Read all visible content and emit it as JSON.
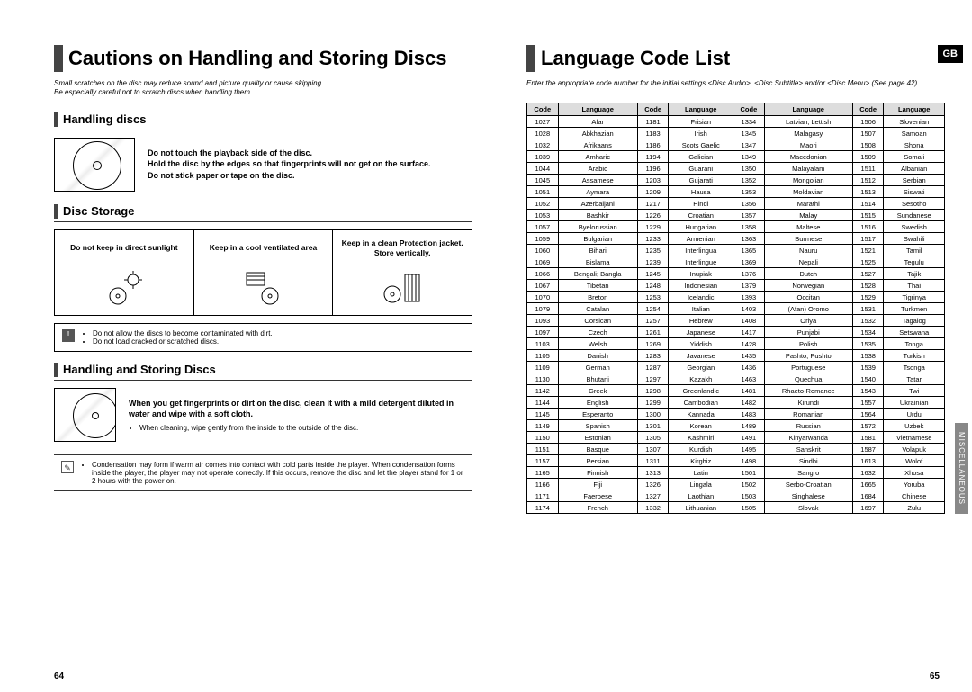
{
  "left": {
    "title": "Cautions on Handling and Storing Discs",
    "intro1": "Small scratches on the disc may reduce sound and picture quality or cause skipping.",
    "intro2": "Be especially careful not to scratch discs when handling them.",
    "h1": "Handling discs",
    "handling_t1": "Do not touch the playback side of the disc.",
    "handling_t2": "Hold the disc by the edges so that fingerprints will not get on the surface.",
    "handling_t3": "Do not stick paper or tape on the disc.",
    "h2": "Disc Storage",
    "storage": [
      "Do not keep in direct sunlight",
      "Keep in a cool ventilated area",
      "Keep in a clean Protection jacket. Store vertically."
    ],
    "note1_a": "Do not allow the discs to become contaminated with dirt.",
    "note1_b": "Do not load cracked or scratched discs.",
    "h3": "Handling and Storing Discs",
    "clean_bold": "When you get fingerprints or dirt on the disc, clean it with a mild detergent diluted in water and wipe with a soft cloth.",
    "clean_bullet": "When cleaning, wipe gently from the inside to the outside of the disc.",
    "note2": "Condensation may form if warm air comes into contact with cold parts inside the player. When condensation forms inside the player, the player may not operate correctly. If this occurs, remove the disc and let the player stand for 1 or 2 hours with the power on.",
    "page": "64"
  },
  "right": {
    "title": "Language Code List",
    "badge": "GB",
    "intro": "Enter the appropriate code number for the initial settings <Disc Audio>, <Disc Subtitle> and/or <Disc Menu> (See page 42).",
    "th_code": "Code",
    "th_lang": "Language",
    "side": "MISCELLANEOUS",
    "page": "65"
  },
  "chart_data": {
    "type": "table",
    "title": "Language Code List",
    "columns": [
      "Code",
      "Language"
    ],
    "rows": [
      [
        "1027",
        "Afar"
      ],
      [
        "1028",
        "Abkhazian"
      ],
      [
        "1032",
        "Afrikaans"
      ],
      [
        "1039",
        "Amharic"
      ],
      [
        "1044",
        "Arabic"
      ],
      [
        "1045",
        "Assamese"
      ],
      [
        "1051",
        "Aymara"
      ],
      [
        "1052",
        "Azerbaijani"
      ],
      [
        "1053",
        "Bashkir"
      ],
      [
        "1057",
        "Byelorussian"
      ],
      [
        "1059",
        "Bulgarian"
      ],
      [
        "1060",
        "Bihari"
      ],
      [
        "1069",
        "Bislama"
      ],
      [
        "1066",
        "Bengali; Bangla"
      ],
      [
        "1067",
        "Tibetan"
      ],
      [
        "1070",
        "Breton"
      ],
      [
        "1079",
        "Catalan"
      ],
      [
        "1093",
        "Corsican"
      ],
      [
        "1097",
        "Czech"
      ],
      [
        "1103",
        "Welsh"
      ],
      [
        "1105",
        "Danish"
      ],
      [
        "1109",
        "German"
      ],
      [
        "1130",
        "Bhutani"
      ],
      [
        "1142",
        "Greek"
      ],
      [
        "1144",
        "English"
      ],
      [
        "1145",
        "Esperanto"
      ],
      [
        "1149",
        "Spanish"
      ],
      [
        "1150",
        "Estonian"
      ],
      [
        "1151",
        "Basque"
      ],
      [
        "1157",
        "Persian"
      ],
      [
        "1165",
        "Finnish"
      ],
      [
        "1166",
        "Fiji"
      ],
      [
        "1171",
        "Faeroese"
      ],
      [
        "1174",
        "French"
      ],
      [
        "1181",
        "Frisian"
      ],
      [
        "1183",
        "Irish"
      ],
      [
        "1186",
        "Scots Gaelic"
      ],
      [
        "1194",
        "Galician"
      ],
      [
        "1196",
        "Guarani"
      ],
      [
        "1203",
        "Gujarati"
      ],
      [
        "1209",
        "Hausa"
      ],
      [
        "1217",
        "Hindi"
      ],
      [
        "1226",
        "Croatian"
      ],
      [
        "1229",
        "Hungarian"
      ],
      [
        "1233",
        "Armenian"
      ],
      [
        "1235",
        "Interlingua"
      ],
      [
        "1239",
        "Interlingue"
      ],
      [
        "1245",
        "Inupiak"
      ],
      [
        "1248",
        "Indonesian"
      ],
      [
        "1253",
        "Icelandic"
      ],
      [
        "1254",
        "Italian"
      ],
      [
        "1257",
        "Hebrew"
      ],
      [
        "1261",
        "Japanese"
      ],
      [
        "1269",
        "Yiddish"
      ],
      [
        "1283",
        "Javanese"
      ],
      [
        "1287",
        "Georgian"
      ],
      [
        "1297",
        "Kazakh"
      ],
      [
        "1298",
        "Greenlandic"
      ],
      [
        "1299",
        "Cambodian"
      ],
      [
        "1300",
        "Kannada"
      ],
      [
        "1301",
        "Korean"
      ],
      [
        "1305",
        "Kashmiri"
      ],
      [
        "1307",
        "Kurdish"
      ],
      [
        "1311",
        "Kirghiz"
      ],
      [
        "1313",
        "Latin"
      ],
      [
        "1326",
        "Lingala"
      ],
      [
        "1327",
        "Laothian"
      ],
      [
        "1332",
        "Lithuanian"
      ],
      [
        "1334",
        "Latvian, Lettish"
      ],
      [
        "1345",
        "Malagasy"
      ],
      [
        "1347",
        "Maori"
      ],
      [
        "1349",
        "Macedonian"
      ],
      [
        "1350",
        "Malayalam"
      ],
      [
        "1352",
        "Mongolian"
      ],
      [
        "1353",
        "Moldavian"
      ],
      [
        "1356",
        "Marathi"
      ],
      [
        "1357",
        "Malay"
      ],
      [
        "1358",
        "Maltese"
      ],
      [
        "1363",
        "Burmese"
      ],
      [
        "1365",
        "Nauru"
      ],
      [
        "1369",
        "Nepali"
      ],
      [
        "1376",
        "Dutch"
      ],
      [
        "1379",
        "Norwegian"
      ],
      [
        "1393",
        "Occitan"
      ],
      [
        "1403",
        "(Afan) Oromo"
      ],
      [
        "1408",
        "Oriya"
      ],
      [
        "1417",
        "Punjabi"
      ],
      [
        "1428",
        "Polish"
      ],
      [
        "1435",
        "Pashto, Pushto"
      ],
      [
        "1436",
        "Portuguese"
      ],
      [
        "1463",
        "Quechua"
      ],
      [
        "1481",
        "Rhaeto-Romance"
      ],
      [
        "1482",
        "Kirundi"
      ],
      [
        "1483",
        "Romanian"
      ],
      [
        "1489",
        "Russian"
      ],
      [
        "1491",
        "Kinyarwanda"
      ],
      [
        "1495",
        "Sanskrit"
      ],
      [
        "1498",
        "Sindhi"
      ],
      [
        "1501",
        "Sangro"
      ],
      [
        "1502",
        "Serbo-Croatian"
      ],
      [
        "1503",
        "Singhalese"
      ],
      [
        "1505",
        "Slovak"
      ],
      [
        "1506",
        "Slovenian"
      ],
      [
        "1507",
        "Samoan"
      ],
      [
        "1508",
        "Shona"
      ],
      [
        "1509",
        "Somali"
      ],
      [
        "1511",
        "Albanian"
      ],
      [
        "1512",
        "Serbian"
      ],
      [
        "1513",
        "Siswati"
      ],
      [
        "1514",
        "Sesotho"
      ],
      [
        "1515",
        "Sundanese"
      ],
      [
        "1516",
        "Swedish"
      ],
      [
        "1517",
        "Swahili"
      ],
      [
        "1521",
        "Tamil"
      ],
      [
        "1525",
        "Tegulu"
      ],
      [
        "1527",
        "Tajik"
      ],
      [
        "1528",
        "Thai"
      ],
      [
        "1529",
        "Tigrinya"
      ],
      [
        "1531",
        "Turkmen"
      ],
      [
        "1532",
        "Tagalog"
      ],
      [
        "1534",
        "Setswana"
      ],
      [
        "1535",
        "Tonga"
      ],
      [
        "1538",
        "Turkish"
      ],
      [
        "1539",
        "Tsonga"
      ],
      [
        "1540",
        "Tatar"
      ],
      [
        "1543",
        "Twi"
      ],
      [
        "1557",
        "Ukrainian"
      ],
      [
        "1564",
        "Urdu"
      ],
      [
        "1572",
        "Uzbek"
      ],
      [
        "1581",
        "Vietnamese"
      ],
      [
        "1587",
        "Volapuk"
      ],
      [
        "1613",
        "Wolof"
      ],
      [
        "1632",
        "Xhosa"
      ],
      [
        "1665",
        "Yoruba"
      ],
      [
        "1684",
        "Chinese"
      ],
      [
        "1697",
        "Zulu"
      ]
    ]
  }
}
